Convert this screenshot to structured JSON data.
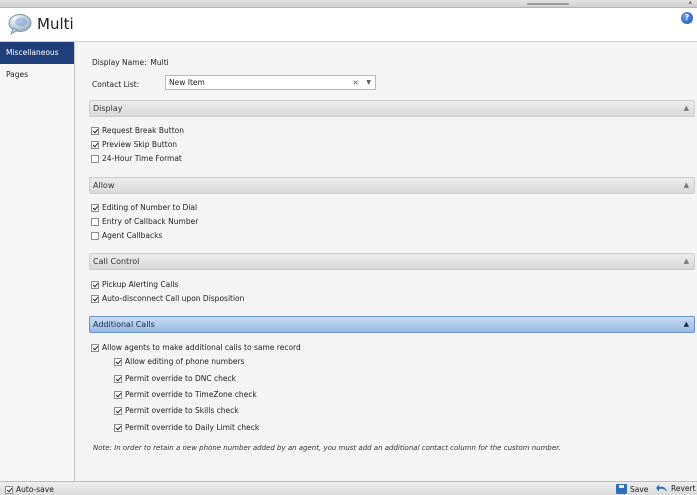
{
  "header": {
    "title": "Multi"
  },
  "sidebar": {
    "items": [
      {
        "label": "Miscellaneous",
        "active": true
      },
      {
        "label": "Pages",
        "active": false
      }
    ]
  },
  "form": {
    "display_name_label": "Display Name:",
    "display_name_value": "Multi",
    "contact_list_label": "Contact List:",
    "contact_list_value": "New Item",
    "clear_glyph": "×",
    "dropdown_glyph": "▼"
  },
  "sections": {
    "display": {
      "title": "Display",
      "items": [
        {
          "label": "Request Break Button",
          "checked": true
        },
        {
          "label": "Preview Skip Button",
          "checked": true
        },
        {
          "label": "24-Hour Time Format",
          "checked": false
        }
      ]
    },
    "allow": {
      "title": "Allow",
      "items": [
        {
          "label": "Editing of Number to Dial",
          "checked": true
        },
        {
          "label": "Entry of Callback Number",
          "checked": false
        },
        {
          "label": "Agent Callbacks",
          "checked": false
        }
      ]
    },
    "call_control": {
      "title": "Call Control",
      "items": [
        {
          "label": "Pickup Alerting Calls",
          "checked": true
        },
        {
          "label": "Auto-disconnect Call upon Disposition",
          "checked": true
        }
      ]
    },
    "additional_calls": {
      "title": "Additional Calls",
      "main_item": {
        "label": "Allow agents to make additional calls to same record",
        "checked": true
      },
      "sub_items": [
        {
          "label": "Allow editing of phone numbers",
          "checked": true
        },
        {
          "label": "Permit override to DNC check",
          "checked": true
        },
        {
          "label": "Permit override to TimeZone check",
          "checked": true
        },
        {
          "label": "Permit override to Skills check",
          "checked": true
        },
        {
          "label": "Permit override to Daily Limit check",
          "checked": true
        }
      ],
      "note": "Note:  In order to retain a new phone number added by an agent, you must add an additional contact column for the custom number."
    }
  },
  "statusbar": {
    "autosave_label": "Auto-save",
    "autosave_checked": true,
    "save_label": "Save",
    "revert_label": "Revert"
  },
  "glyphs": {
    "collapse": "▲",
    "help": "?"
  },
  "colors": {
    "active_sidebar": "#1e3f7a",
    "active_section": "#98b9e3",
    "accent_icon": "#2f6fb3"
  }
}
